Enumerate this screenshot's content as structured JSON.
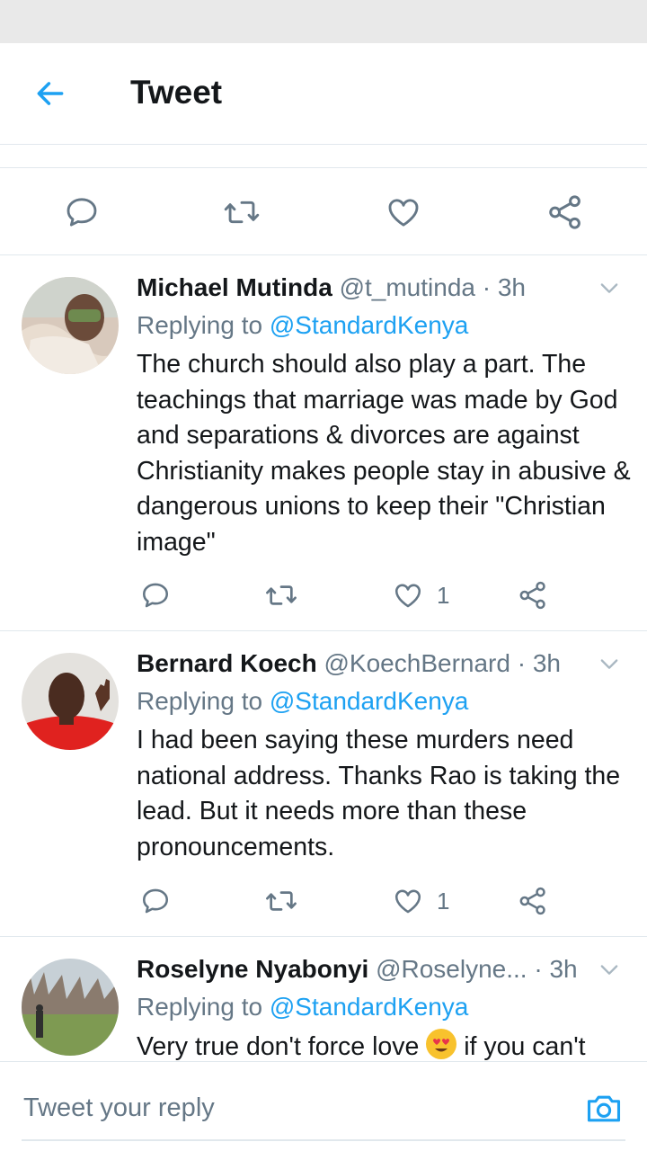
{
  "header": {
    "title": "Tweet"
  },
  "colors": {
    "accent": "#1da1f2",
    "muted": "#657786",
    "text": "#14171a"
  },
  "tweets": [
    {
      "name": "Michael Mutinda",
      "handle": "@t_mutinda",
      "time": "· 3h",
      "reply_prefix": "Replying to",
      "reply_to": "@StandardKenya",
      "text": "The church should also play a part. The teachings that marriage was made by God and separations & divorces are against Christianity makes people stay in abusive & dangerous unions to keep their \"Christian image\"",
      "likes": "1"
    },
    {
      "name": "Bernard Koech",
      "handle": "@KoechBernard",
      "time": "· 3h",
      "reply_prefix": "Replying to",
      "reply_to": "@StandardKenya",
      "text": "I had been saying these murders need national address. Thanks Rao is taking the lead. But it needs more than these pronouncements.",
      "likes": "1"
    },
    {
      "name": "Roselyne Nyabonyi",
      "handle": "@Roselyne...",
      "time": "· 3h",
      "reply_prefix": "Replying to",
      "reply_to": "@StandardKenya",
      "text_before_emoji": "Very true don't force love",
      "text_after_emoji": " if you can't"
    }
  ],
  "reply_bar": {
    "placeholder": "Tweet your reply"
  }
}
